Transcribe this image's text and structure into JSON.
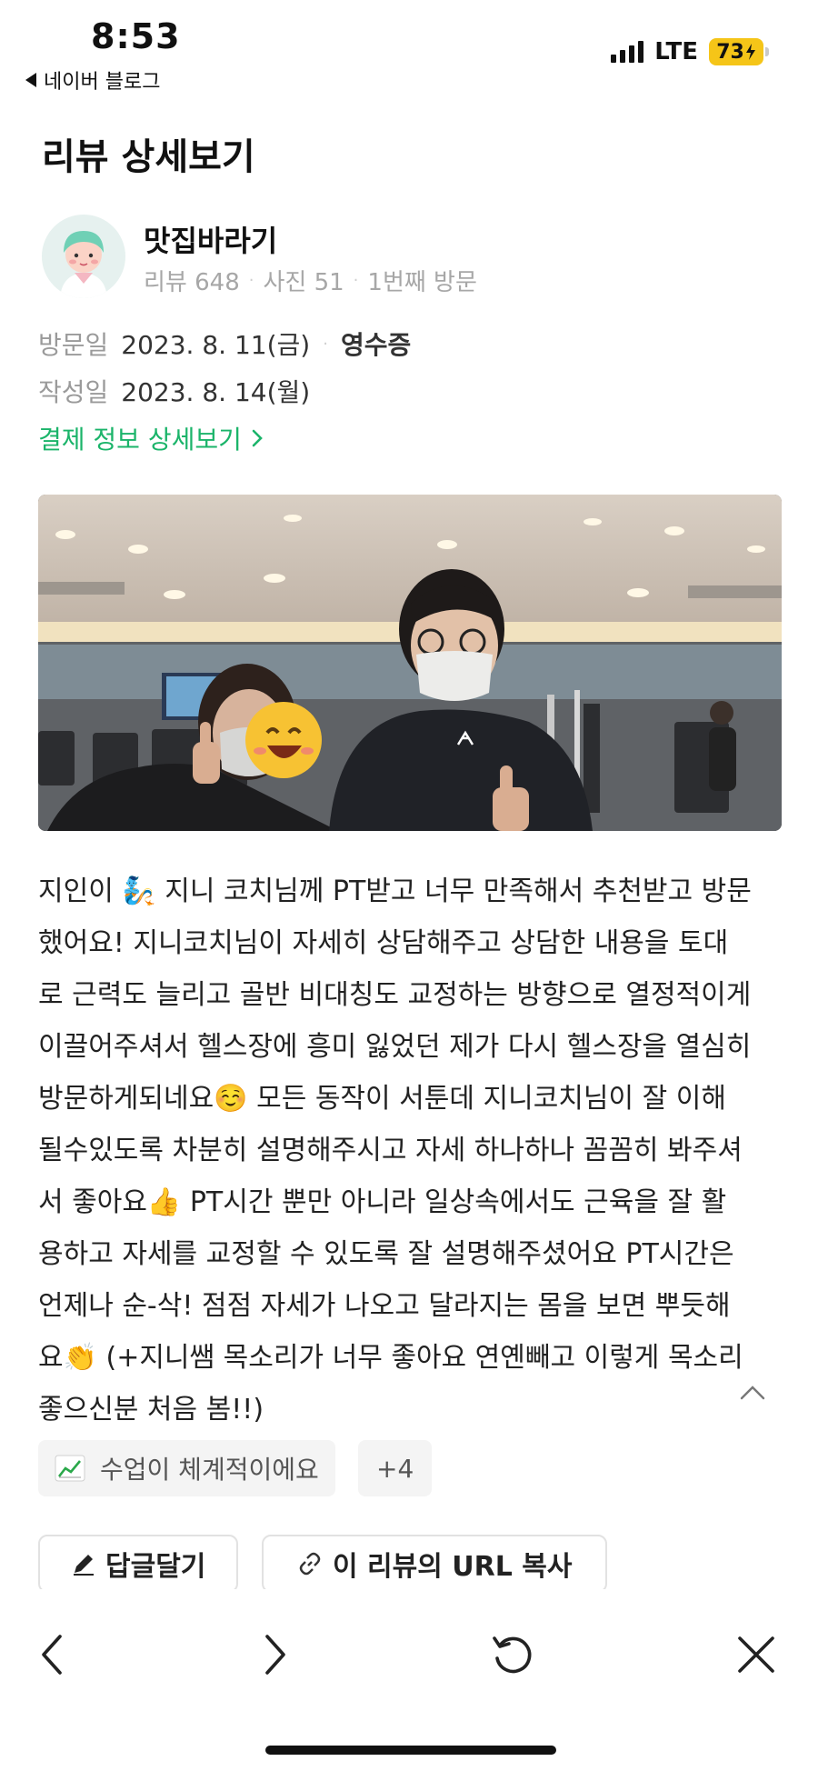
{
  "status_bar": {
    "time": "8:53",
    "back_app": "네이버 블로그",
    "network": "LTE",
    "battery": "73"
  },
  "page": {
    "title": "리뷰 상세보기"
  },
  "reviewer": {
    "name": "맛집바라기",
    "reviews": "리뷰 648",
    "photos": "사진 51",
    "visit_count": "1번째 방문"
  },
  "visit": {
    "visit_label": "방문일",
    "visit_date": "2023. 8. 11(금)",
    "receipt": "영수증",
    "written_label": "작성일",
    "written_date": "2023. 8. 14(월)",
    "payment_link": "결제 정보 상세보기"
  },
  "review": {
    "lines": [
      "지인이 🧞 지니 코치님께 PT받고 너무 만족해서 추천받고 방문",
      "했어요! 지니코치님이 자세히 상담해주고 상담한 내용을 토대",
      "로 근력도 늘리고 골반 비대칭도 교정하는 방향으로 열정적이게",
      "이끌어주셔서 헬스장에 흥미 잃었던 제가 다시 헬스장을 열심히",
      "방문하게되네요☺️ 모든 동작이 서툰데 지니코치님이 잘 이해",
      "될수있도록 차분히 설명해주시고 자세 하나하나 꼼꼼히 봐주셔",
      "서 좋아요👍 PT시간 뿐만 아니라 일상속에서도 근육을 잘 활",
      "용하고 자세를 교정할 수 있도록 잘 설명해주셨어요 PT시간은",
      "언제나 순-삭! 점점 자세가 나오고 달라지는 몸을 보면 뿌듯해",
      "요👏 (+지니쌤 목소리가 너무 좋아요 연옌빼고 이렇게 목소리",
      "좋으신분 처음 봄!!)"
    ]
  },
  "tags": {
    "first": "수업이 체계적이에요",
    "more": "+4"
  },
  "actions": {
    "reply": "답글달기",
    "copy_url": "이 리뷰의 URL 복사"
  },
  "colors": {
    "accent_green": "#1bb46a",
    "battery_yellow": "#f5c518"
  }
}
